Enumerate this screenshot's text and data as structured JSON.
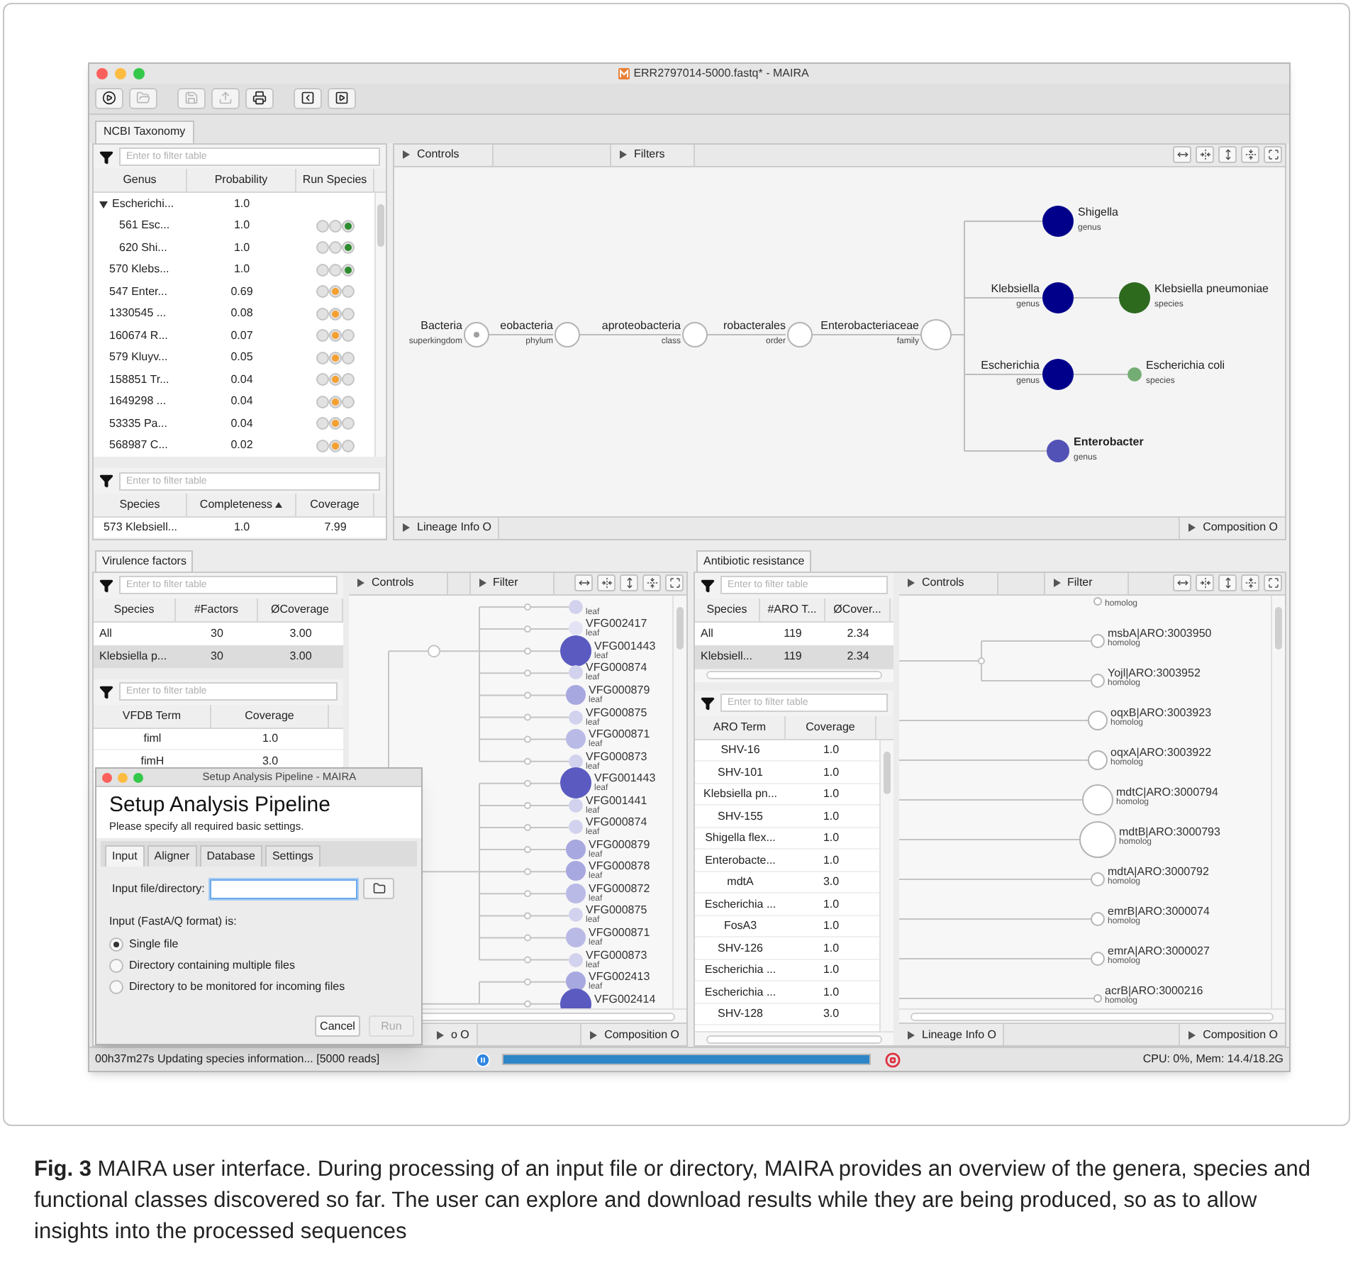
{
  "window": {
    "title": "ERR2797014-5000.fastq* - MAIRA"
  },
  "toolbar": [
    {
      "kind": "run",
      "disabled": false
    },
    {
      "kind": "open",
      "disabled": true
    },
    {
      "kind": "save",
      "disabled": true
    },
    {
      "kind": "export",
      "disabled": true
    },
    {
      "kind": "print",
      "disabled": false
    },
    {
      "kind": "back",
      "disabled": false
    },
    {
      "kind": "forward",
      "disabled": false
    }
  ],
  "taxonomy": {
    "tab": "NCBI Taxonomy",
    "genus_filter": {
      "placeholder": "Enter to filter table"
    },
    "genus_columns": [
      "Genus",
      "Probability",
      "Run Species"
    ],
    "genus_rows": [
      {
        "genus": "Escherichi...",
        "probability": "1.0",
        "expanded": true,
        "children": [
          {
            "genus": "561 Esc...",
            "probability": "1.0",
            "finished": true
          },
          {
            "genus": "620 Shi...",
            "probability": "1.0",
            "finished": true
          }
        ]
      },
      {
        "genus": "570 Klebs...",
        "probability": "1.0",
        "finished": true
      },
      {
        "genus": "547 Enter...",
        "probability": "0.69",
        "finished": false
      },
      {
        "genus": "1330545 ...",
        "probability": "0.08",
        "finished": false
      },
      {
        "genus": "160674 R...",
        "probability": "0.07",
        "finished": false
      },
      {
        "genus": "579 Kluyv...",
        "probability": "0.05",
        "finished": false
      },
      {
        "genus": "158851 Tr...",
        "probability": "0.04",
        "finished": false
      },
      {
        "genus": "1649298 ...",
        "probability": "0.04",
        "finished": false
      },
      {
        "genus": "53335 Pa...",
        "probability": "0.04",
        "finished": false
      },
      {
        "genus": "568987 C...",
        "probability": "0.02",
        "finished": false
      }
    ],
    "species_filter": {
      "placeholder": "Enter to filter table"
    },
    "species_columns": [
      {
        "label": "Species",
        "sorted": false
      },
      {
        "label": "Completeness",
        "sorted": true
      },
      {
        "label": "Coverage",
        "sorted": false
      }
    ],
    "species_rows": [
      [
        "573 Klebsiell...",
        "1.0",
        "7.99"
      ]
    ],
    "controls": "Controls",
    "filters": "Filters",
    "lineage_info": "Lineage Info O",
    "composition": "Composition O",
    "lineage": [
      {
        "name": "Bacteria",
        "rank": "superkingdom"
      },
      {
        "name": "eobacteria",
        "rank": "phylum"
      },
      {
        "name": "aproteobacteria",
        "rank": "class"
      },
      {
        "name": "robacterales",
        "rank": "order"
      },
      {
        "name": "Enterobacteriaceae",
        "rank": "family"
      }
    ],
    "genera": [
      {
        "name": "Shigella",
        "rank": "genus",
        "color": "#00008b",
        "highlighted": false
      },
      {
        "name": "Klebsiella",
        "rank": "genus",
        "color": "#00008b",
        "highlighted": false,
        "species": {
          "name": "Klebsiella pneumoniae",
          "rank": "species",
          "color": "#2d6a1e",
          "kind": "large"
        }
      },
      {
        "name": "Escherichia",
        "rank": "genus",
        "color": "#00008b",
        "highlighted": false,
        "species": {
          "name": "Escherichia coli",
          "rank": "species",
          "color": "#74ad74",
          "kind": "small"
        }
      },
      {
        "name": "Enterobacter",
        "rank": "genus",
        "color": "#5252b6",
        "highlighted": true
      }
    ]
  },
  "virulence": {
    "tab": "Virulence factors",
    "species_filter": {
      "placeholder": "Enter to filter table"
    },
    "species_columns": [
      "Species",
      "#Factors",
      "ØCoverage"
    ],
    "species_rows": [
      {
        "cells": [
          "All",
          "30",
          "3.00"
        ],
        "selected": false
      },
      {
        "cells": [
          "Klebsiella p...",
          "30",
          "3.00"
        ],
        "selected": true
      }
    ],
    "term_filter": {
      "placeholder": "Enter to filter table"
    },
    "term_columns": [
      "VFDB Term",
      "Coverage"
    ],
    "term_rows": [
      [
        "fiml",
        "1.0"
      ],
      [
        "fimH",
        "3.0"
      ]
    ],
    "controls": "Controls",
    "filter": "Filter",
    "lineage_info": "o O",
    "composition": "Composition O",
    "leaves": [
      {
        "sub": "leaf",
        "kind": "small",
        "color": "#d2d2ee"
      },
      {
        "name": "VFG002417",
        "sub": "leaf",
        "kind": "small",
        "color": "#e2e2f4"
      },
      {
        "name": "VFG001443",
        "sub": "leaf",
        "kind": "large",
        "color": "#5a5ac0"
      },
      {
        "name": "VFG000874",
        "sub": "leaf",
        "kind": "small",
        "color": "#d2d2ee"
      },
      {
        "name": "VFG000879",
        "sub": "leaf",
        "kind": "medium",
        "color": "#a8a8e0"
      },
      {
        "name": "VFG000875",
        "sub": "leaf",
        "kind": "small",
        "color": "#d2d2ee"
      },
      {
        "name": "VFG000871",
        "sub": "leaf",
        "kind": "medium",
        "color": "#babae6"
      },
      {
        "name": "VFG000873",
        "sub": "leaf",
        "kind": "small",
        "color": "#d2d2ee"
      },
      {
        "name": "VFG001443",
        "sub": "leaf",
        "kind": "large",
        "color": "#5a5ac0"
      },
      {
        "name": "VFG001441",
        "sub": "leaf",
        "kind": "small",
        "color": "#d2d2ee"
      },
      {
        "name": "VFG000874",
        "sub": "leaf",
        "kind": "small",
        "color": "#d2d2ee"
      },
      {
        "name": "VFG000879",
        "sub": "leaf",
        "kind": "medium",
        "color": "#a8a8e0"
      },
      {
        "name": "VFG000878",
        "sub": "leaf",
        "kind": "medium",
        "color": "#a8a8e0"
      },
      {
        "name": "VFG000872",
        "sub": "leaf",
        "kind": "medium",
        "color": "#babae6"
      },
      {
        "name": "VFG000875",
        "sub": "leaf",
        "kind": "small",
        "color": "#d2d2ee"
      },
      {
        "name": "VFG000871",
        "sub": "leaf",
        "kind": "medium",
        "color": "#babae6"
      },
      {
        "name": "VFG000873",
        "sub": "leaf",
        "kind": "small",
        "color": "#d2d2ee"
      },
      {
        "name": "VFG002413",
        "sub": "leaf",
        "kind": "medium",
        "color": "#a8a8e0"
      },
      {
        "name": "VFG002414",
        "kind": "large",
        "color": "#5a5ac0"
      }
    ]
  },
  "resistance": {
    "tab": "Antibiotic resistance",
    "species_filter": {
      "placeholder": "Enter to filter table"
    },
    "species_columns": [
      "Species",
      "#ARO T...",
      "ØCover..."
    ],
    "species_rows": [
      {
        "cells": [
          "All",
          "119",
          "2.34"
        ],
        "selected": false
      },
      {
        "cells": [
          "Klebsiell...",
          "119",
          "2.34"
        ],
        "selected": true
      }
    ],
    "term_filter": {
      "placeholder": "Enter to filter table"
    },
    "term_columns": [
      "ARO Term",
      "Coverage"
    ],
    "term_rows": [
      [
        "SHV-16",
        "1.0"
      ],
      [
        "SHV-101",
        "1.0"
      ],
      [
        "Klebsiella pn...",
        "1.0"
      ],
      [
        "SHV-155",
        "1.0"
      ],
      [
        "Shigella flex...",
        "1.0"
      ],
      [
        "Enterobacte...",
        "1.0"
      ],
      [
        "mdtA",
        "3.0"
      ],
      [
        "Escherichia ...",
        "1.0"
      ],
      [
        "FosA3",
        "1.0"
      ],
      [
        "SHV-126",
        "1.0"
      ],
      [
        "Escherichia ...",
        "1.0"
      ],
      [
        "Escherichia ...",
        "1.0"
      ],
      [
        "SHV-128",
        "3.0"
      ]
    ],
    "controls": "Controls",
    "filter": "Filter",
    "lineage_info": "Lineage Info O",
    "composition": "Composition O",
    "leaves": [
      {
        "sub": "homolog",
        "kind": "tiny"
      },
      {
        "name": "msbA|ARO:3003950",
        "sub": "homolog",
        "kind": "small"
      },
      {
        "name": "Yojl|ARO:3003952",
        "sub": "homolog",
        "kind": "small"
      },
      {
        "name": "oqxB|ARO:3003923",
        "sub": "homolog",
        "kind": "medium"
      },
      {
        "name": "oqxA|ARO:3003922",
        "sub": "homolog",
        "kind": "medium"
      },
      {
        "name": "mdtC|ARO:3000794",
        "sub": "homolog",
        "kind": "large"
      },
      {
        "name": "mdtB|ARO:3000793",
        "sub": "homolog",
        "kind": "xlarge"
      },
      {
        "name": "mdtA|ARO:3000792",
        "sub": "homolog",
        "kind": "small"
      },
      {
        "name": "emrB|ARO:3000074",
        "sub": "homolog",
        "kind": "small"
      },
      {
        "name": "emrA|ARO:3000027",
        "sub": "homolog",
        "kind": "small"
      },
      {
        "name": "acrB|ARO:3000216",
        "sub": "homolog",
        "kind": "tiny"
      }
    ]
  },
  "dialog": {
    "window_title": "Setup Analysis Pipeline - MAIRA",
    "heading": "Setup Analysis Pipeline",
    "subtitle": "Please specify all required basic settings.",
    "tabs": [
      {
        "label": "Input",
        "selected": true
      },
      {
        "label": "Aligner",
        "selected": false
      },
      {
        "label": "Database",
        "selected": false
      },
      {
        "label": "Settings",
        "selected": false
      }
    ],
    "input_label": "Input file/directory:",
    "input_focused": true,
    "format_label": "Input (FastA/Q format) is:",
    "options": [
      {
        "label": "Single file",
        "selected": true
      },
      {
        "label": "Directory containing multiple files",
        "selected": false
      },
      {
        "label": "Directory to be monitored for incoming files",
        "selected": false
      }
    ],
    "buttons": [
      {
        "label": "Cancel",
        "disabled": false
      },
      {
        "label": "Run",
        "disabled": true
      }
    ]
  },
  "status_bar": {
    "message": "00h37m27s Updating species information... [5000 reads]",
    "progress": {
      "level": 1.0
    },
    "resources": "CPU: 0%, Mem: 14.4/18.2G"
  },
  "caption": "**Fig. 3**  MAIRA user interface. During processing of an input file or directory, MAIRA provides an overview of the genera, species and functional classes discovered so far. The user can explore and download results while they are being produced, so as to allow insights into the processed sequences"
}
